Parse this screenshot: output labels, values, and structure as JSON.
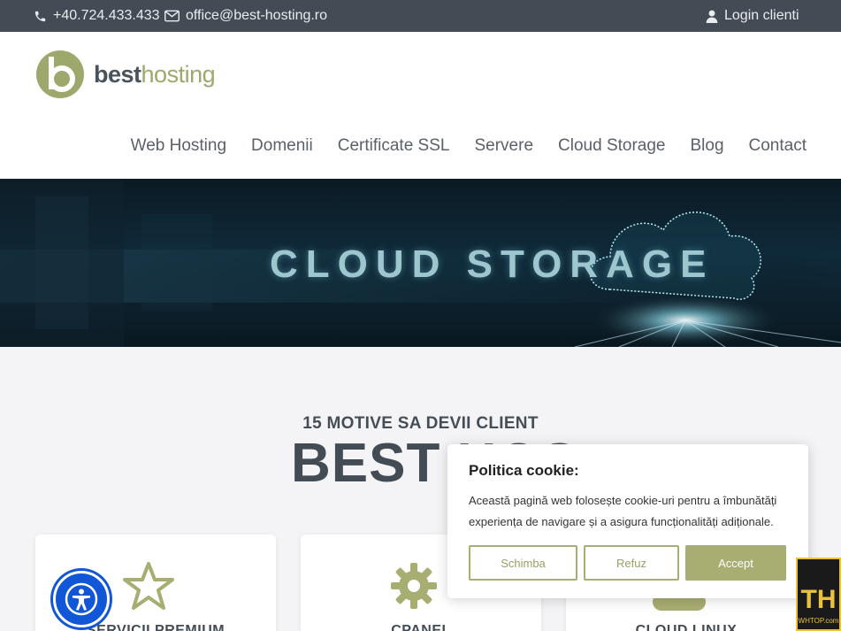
{
  "topbar": {
    "phone": "+40.724.433.433",
    "email": "office@best-hosting.ro",
    "login": "Login clienti"
  },
  "logo": {
    "brand_part1": "best",
    "brand_part2": "hosting"
  },
  "nav": {
    "items": [
      {
        "label": "Web Hosting"
      },
      {
        "label": "Domenii"
      },
      {
        "label": "Certificate SSL"
      },
      {
        "label": "Servere"
      },
      {
        "label": "Cloud Storage"
      },
      {
        "label": "Blog"
      },
      {
        "label": "Contact"
      }
    ]
  },
  "hero": {
    "title": "CLOUD STORAGE"
  },
  "section": {
    "subtitle": "15 MOTIVE SA DEVII CLIENT",
    "title": "BEST HOS",
    "cards": [
      {
        "title": "SERVICII PREMIUM",
        "icon": "star-icon"
      },
      {
        "title": "CPANEL",
        "icon": "gear-icon"
      },
      {
        "title": "CLOUD LINUX",
        "icon": "cloud-icon"
      }
    ]
  },
  "cookie": {
    "title": "Politica cookie:",
    "text": "Această pagină web folosește cookie-uri pentru a îmbunătăți experiența de navigare și a asigura funcționalități adiționale.",
    "btn_change": "Schimba",
    "btn_refuse": "Refuz",
    "btn_accept": "Accept"
  },
  "watermark": {
    "letters": "TH",
    "text": "WHTOP.com"
  },
  "colors": {
    "topbar": "#434c54",
    "accent": "#a8ad72",
    "text_dark": "#434c55",
    "access_blue": "#1156d6"
  }
}
